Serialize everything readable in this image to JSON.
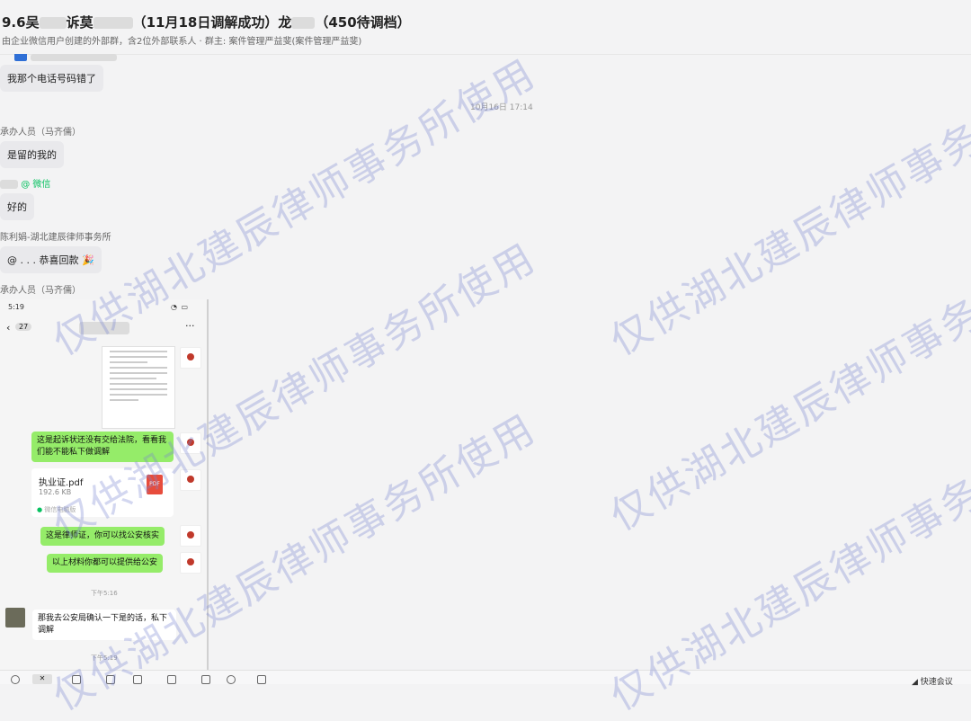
{
  "header": {
    "title_part1": "9.6吴",
    "title_part2": "诉莫",
    "title_part3": "（11月18日调解成功）龙",
    "title_part4": "（450待调档）",
    "subtitle": "由企业微信用户创建的外部群，含2位外部联系人 · 群主: 案件管理严益斐(案件管理严益斐)"
  },
  "messages": {
    "m1": "我那个电话号码错了",
    "timestamp1": "10月16日 17:14",
    "sender2": "承办人员（马齐儒）",
    "m2": "是留的我的",
    "sender3_tag": "@ 微信",
    "m3": "好的",
    "sender4": "陈利娟-湖北建辰律师事务所",
    "m4": "@ . . .  恭喜回款",
    "m4_emoji": "🎉",
    "sender5": "承办人员（马齐儒）"
  },
  "screenshot": {
    "status_time": "5:19",
    "back_count": "27",
    "more": "···",
    "msg_green1": "这是起诉状还没有交给法院，看看我们能不能私下做调解",
    "file_name": "执业证.pdf",
    "file_size": "192.6 KB",
    "file_badge": "PDF",
    "file_source": "微信电脑版",
    "msg_green2": "这是律师证，你可以找公安核实",
    "msg_green3": "以上材料你都可以提供给公安",
    "time1": "下午5:16",
    "msg_white": "那我去公安局确认一下是的话，私下调解",
    "time2": "下午5:19"
  },
  "toolbar": {
    "right_label": "快速会议"
  },
  "watermark": {
    "text": "仅供湖北建辰律师事务所使用"
  },
  "colors": {
    "green_bubble": "#95ec69",
    "wechat_green": "#07c160",
    "watermark": "#7887d2"
  }
}
